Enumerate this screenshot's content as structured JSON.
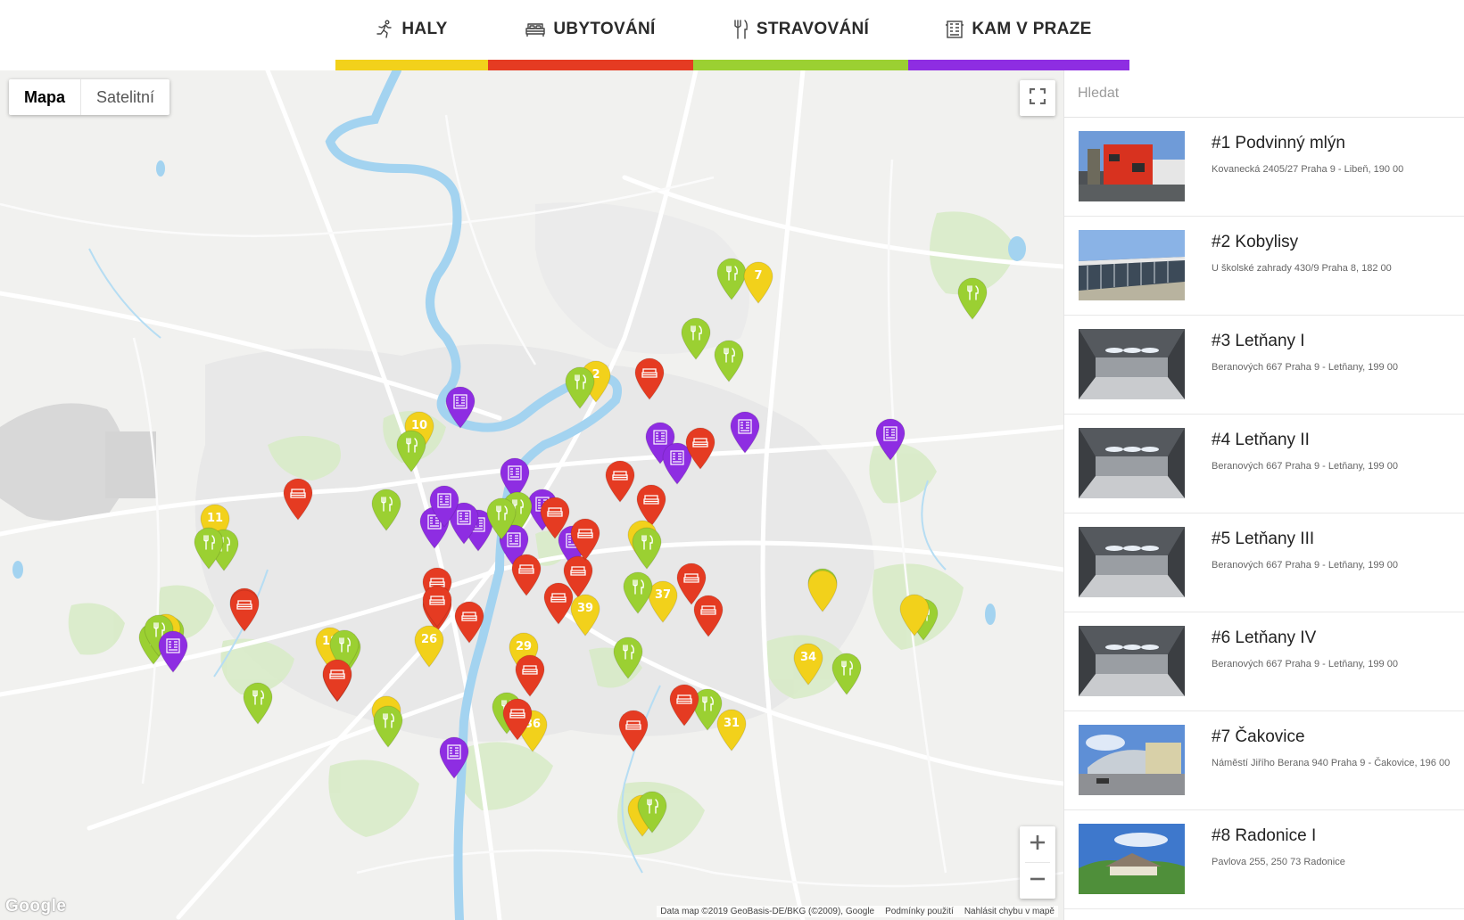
{
  "tabs": [
    {
      "label": "HALY",
      "icon": "runner-icon",
      "color": "#f2d11b"
    },
    {
      "label": "UBYTOVÁNÍ",
      "icon": "bed-icon",
      "color": "#e53b22"
    },
    {
      "label": "STRAVOVÁNÍ",
      "icon": "fork-knife-icon",
      "color": "#9bd032"
    },
    {
      "label": "KAM V PRAZE",
      "icon": "building-icon",
      "color": "#8e2de2"
    }
  ],
  "map": {
    "map_types": [
      "Mapa",
      "Satelitní"
    ],
    "active_map_type": "Mapa",
    "attribution": [
      "Data map ©2019 GeoBasis-DE/BKG (©2009), Google",
      "Podmínky použití",
      "Nahlásit chybu v mapě"
    ],
    "google_logo": "Google"
  },
  "pins": [
    {
      "category": "stravovani",
      "num": ""
    },
    {
      "category": "haly",
      "num": "7"
    },
    {
      "category": "stravovani",
      "num": ""
    },
    {
      "category": "stravovani",
      "num": ""
    },
    {
      "category": "stravovani",
      "num": ""
    },
    {
      "category": "haly",
      "num": "2"
    },
    {
      "category": "stravovani",
      "num": ""
    },
    {
      "category": "ubytovani",
      "num": ""
    },
    {
      "category": "kam",
      "num": ""
    },
    {
      "category": "kam",
      "num": ""
    },
    {
      "category": "kam",
      "num": ""
    },
    {
      "category": "haly",
      "num": "10"
    },
    {
      "category": "stravovani",
      "num": ""
    },
    {
      "category": "kam",
      "num": ""
    },
    {
      "category": "kam",
      "num": ""
    },
    {
      "category": "ubytovani",
      "num": ""
    },
    {
      "category": "ubytovani",
      "num": ""
    },
    {
      "category": "ubytovani",
      "num": ""
    },
    {
      "category": "ubytovani",
      "num": ""
    },
    {
      "category": "stravovani",
      "num": ""
    },
    {
      "category": "haly",
      "num": "11"
    },
    {
      "category": "stravovani",
      "num": ""
    },
    {
      "category": "stravovani",
      "num": ""
    },
    {
      "category": "kam",
      "num": ""
    },
    {
      "category": "kam",
      "num": ""
    },
    {
      "category": "kam",
      "num": ""
    },
    {
      "category": "kam",
      "num": ""
    },
    {
      "category": "stravovani",
      "num": ""
    },
    {
      "category": "kam",
      "num": ""
    },
    {
      "category": "kam",
      "num": ""
    },
    {
      "category": "ubytovani",
      "num": ""
    },
    {
      "category": "ubytovani",
      "num": ""
    },
    {
      "category": "ubytovani",
      "num": ""
    },
    {
      "category": "kam",
      "num": ""
    },
    {
      "category": "stravovani",
      "num": ""
    },
    {
      "category": "ubytovani",
      "num": ""
    },
    {
      "category": "kam",
      "num": ""
    },
    {
      "category": "ubytovani",
      "num": ""
    },
    {
      "category": "haly",
      "num": ""
    },
    {
      "category": "stravovani",
      "num": ""
    },
    {
      "category": "ubytovani",
      "num": ""
    },
    {
      "category": "ubytovani",
      "num": ""
    },
    {
      "category": "ubytovani",
      "num": ""
    },
    {
      "category": "ubytovani",
      "num": ""
    },
    {
      "category": "haly",
      "num": "39"
    },
    {
      "category": "haly",
      "num": "37"
    },
    {
      "category": "stravovani",
      "num": ""
    },
    {
      "category": "ubytovani",
      "num": ""
    },
    {
      "category": "ubytovani",
      "num": ""
    },
    {
      "category": "stravovani",
      "num": ""
    },
    {
      "category": "haly",
      "num": ""
    },
    {
      "category": "stravovani",
      "num": ""
    },
    {
      "category": "haly",
      "num": ""
    },
    {
      "category": "stravovani",
      "num": ""
    },
    {
      "category": "stravovani",
      "num": ""
    },
    {
      "category": "ubytovani",
      "num": ""
    },
    {
      "category": "haly",
      "num": "6"
    },
    {
      "category": "stravovani",
      "num": ""
    },
    {
      "category": "kam",
      "num": ""
    },
    {
      "category": "ubytovani",
      "num": ""
    },
    {
      "category": "haly",
      "num": "26"
    },
    {
      "category": "stravovani",
      "num": ""
    },
    {
      "category": "ubytovani",
      "num": ""
    },
    {
      "category": "haly",
      "num": "18"
    },
    {
      "category": "stravovani",
      "num": ""
    },
    {
      "category": "ubytovani",
      "num": ""
    },
    {
      "category": "haly",
      "num": "29"
    },
    {
      "category": "stravovani",
      "num": ""
    },
    {
      "category": "haly",
      "num": "34"
    },
    {
      "category": "stravovani",
      "num": ""
    },
    {
      "category": "stravovani",
      "num": ""
    },
    {
      "category": "haly",
      "num": ""
    },
    {
      "category": "stravovani",
      "num": ""
    },
    {
      "category": "stravovani",
      "num": ""
    },
    {
      "category": "ubytovani",
      "num": ""
    },
    {
      "category": "haly",
      "num": "36"
    },
    {
      "category": "ubytovani",
      "num": ""
    },
    {
      "category": "stravovani",
      "num": ""
    },
    {
      "category": "ubytovani",
      "num": ""
    },
    {
      "category": "haly",
      "num": "31"
    },
    {
      "category": "kam",
      "num": ""
    },
    {
      "category": "ubytovani",
      "num": ""
    },
    {
      "category": "haly",
      "num": ""
    },
    {
      "category": "stravovani",
      "num": ""
    }
  ],
  "sidebar": {
    "search_placeholder": "Hledat",
    "items": [
      {
        "title": "#1 Podvinný mlýn",
        "address": "Kovanecká 2405/27 Praha 9 - Libeň, 190 00",
        "thumb": "red-building"
      },
      {
        "title": "#2 Kobylisy",
        "address": "U školské zahrady 430/9 Praha 8, 182 00",
        "thumb": "glass-hall"
      },
      {
        "title": "#3 Letňany I",
        "address": "Beranových 667 Praha 9 - Letňany, 199 00",
        "thumb": "hall-interior"
      },
      {
        "title": "#4 Letňany II",
        "address": "Beranových 667 Praha 9 - Letňany, 199 00",
        "thumb": "hall-interior"
      },
      {
        "title": "#5 Letňany III",
        "address": "Beranových 667 Praha 9 - Letňany, 199 00",
        "thumb": "hall-interior"
      },
      {
        "title": "#6 Letňany IV",
        "address": "Beranových 667 Praha 9 - Letňany, 199 00",
        "thumb": "hall-interior"
      },
      {
        "title": "#7 Čakovice",
        "address": "Náměstí Jiřího Berana 940 Praha 9 - Čakovice, 196 00",
        "thumb": "sports-hall"
      },
      {
        "title": "#8 Radonice I",
        "address": "Pavlova 255, 250 73 Radonice",
        "thumb": "countryside-hall"
      }
    ]
  }
}
